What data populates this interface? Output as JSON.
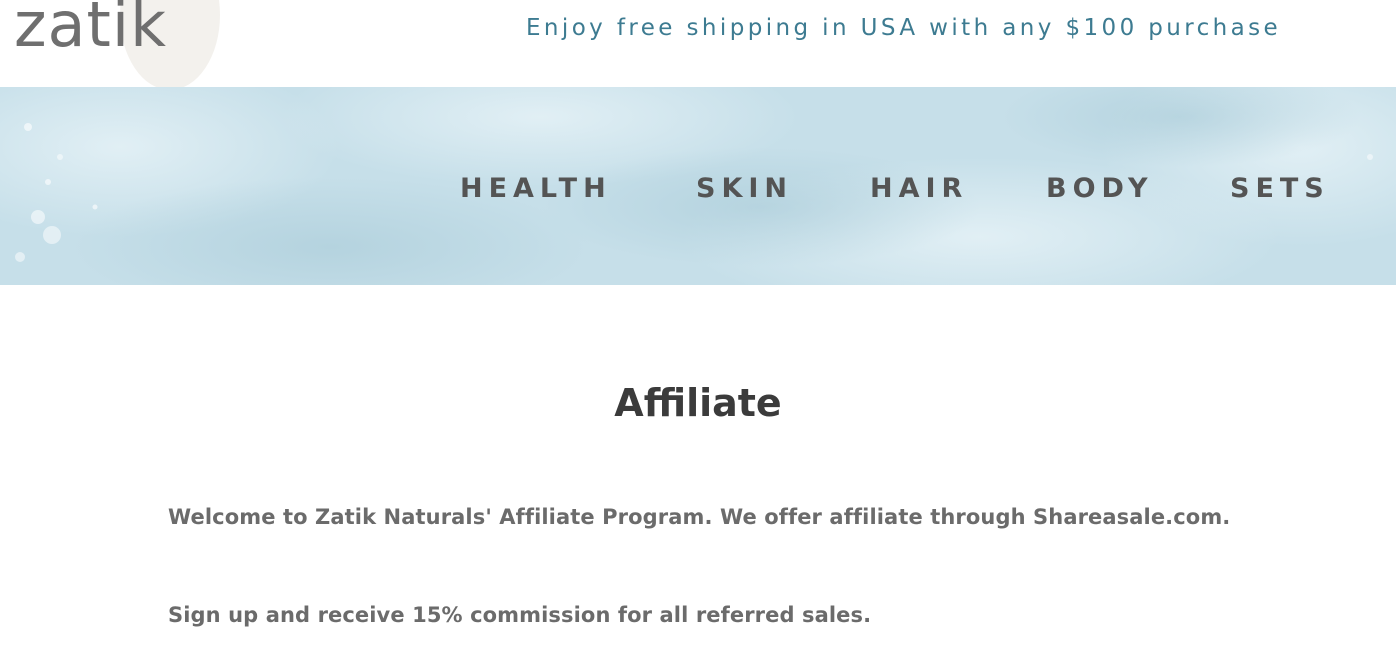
{
  "brand": {
    "logo_text": "zatik"
  },
  "promo": {
    "text": "Enjoy free shipping in USA with any $100 purchase"
  },
  "nav": {
    "items": [
      {
        "label": "HEALTH"
      },
      {
        "label": "SKIN"
      },
      {
        "label": "HAIR"
      },
      {
        "label": "BODY"
      },
      {
        "label": "SETS"
      }
    ]
  },
  "main": {
    "title": "Affiliate",
    "paragraphs": [
      "Welcome to Zatik Naturals' Affiliate Program. We offer affiliate through Shareasale.com.",
      "Sign up and receive 15% commission for all referred sales."
    ]
  },
  "colors": {
    "promo_text": "#3d7b91",
    "nav_band": "#c9e1ea",
    "nav_text": "#545454",
    "title_text": "#3b3b3b",
    "body_text": "#6b6b6b"
  }
}
